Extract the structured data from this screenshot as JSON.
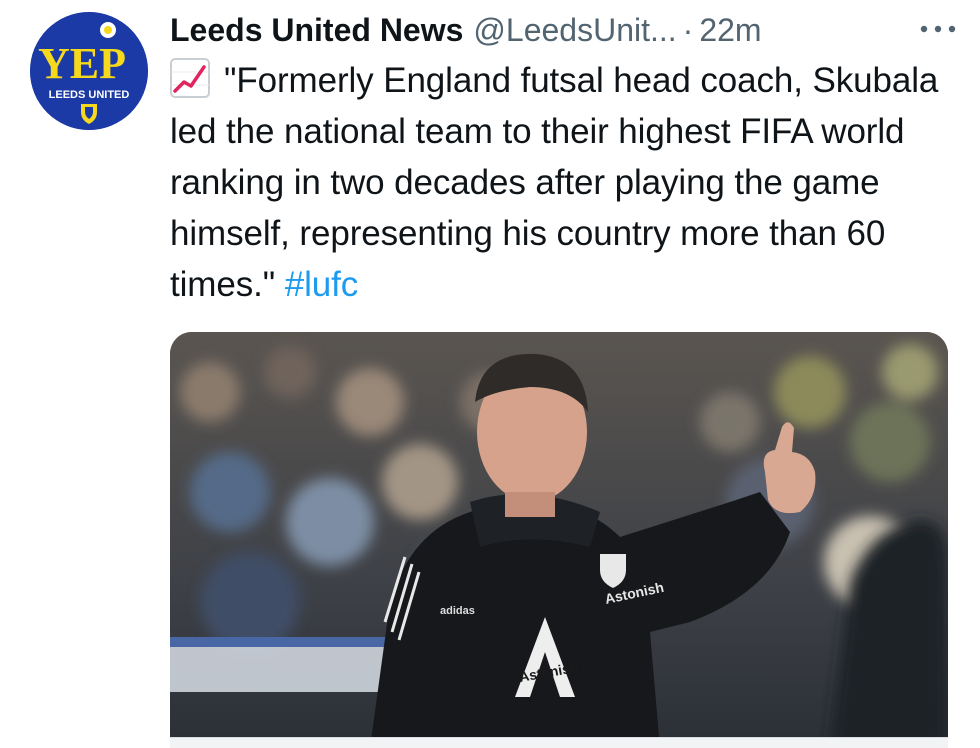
{
  "account": {
    "name": "Leeds United News",
    "handle": "@LeedsUnit...",
    "separator": "·",
    "time": "22m",
    "avatar": {
      "main_text": "YEP",
      "sub_text": "LEEDS UNITED",
      "background": "#1b3aa6",
      "text_color": "#f6d81c"
    }
  },
  "more_menu": {
    "icon": "more-horizontal-icon",
    "glyph": "•••"
  },
  "tweet": {
    "emoji": "chart-increasing-icon",
    "text": "\"Formerly England futsal head coach, Skubala led the national team to their highest FIFA world ranking in two decades after playing the game himself, representing his country more than 60 times.\"",
    "hashtag": "#lufc"
  },
  "media": {
    "kit_text_chest": "Astonish",
    "kit_text_front": "Astonish",
    "kit_brand": "adidas"
  },
  "colors": {
    "link": "#1d9bf0",
    "secondary": "#536471",
    "primary": "#0f1419"
  }
}
